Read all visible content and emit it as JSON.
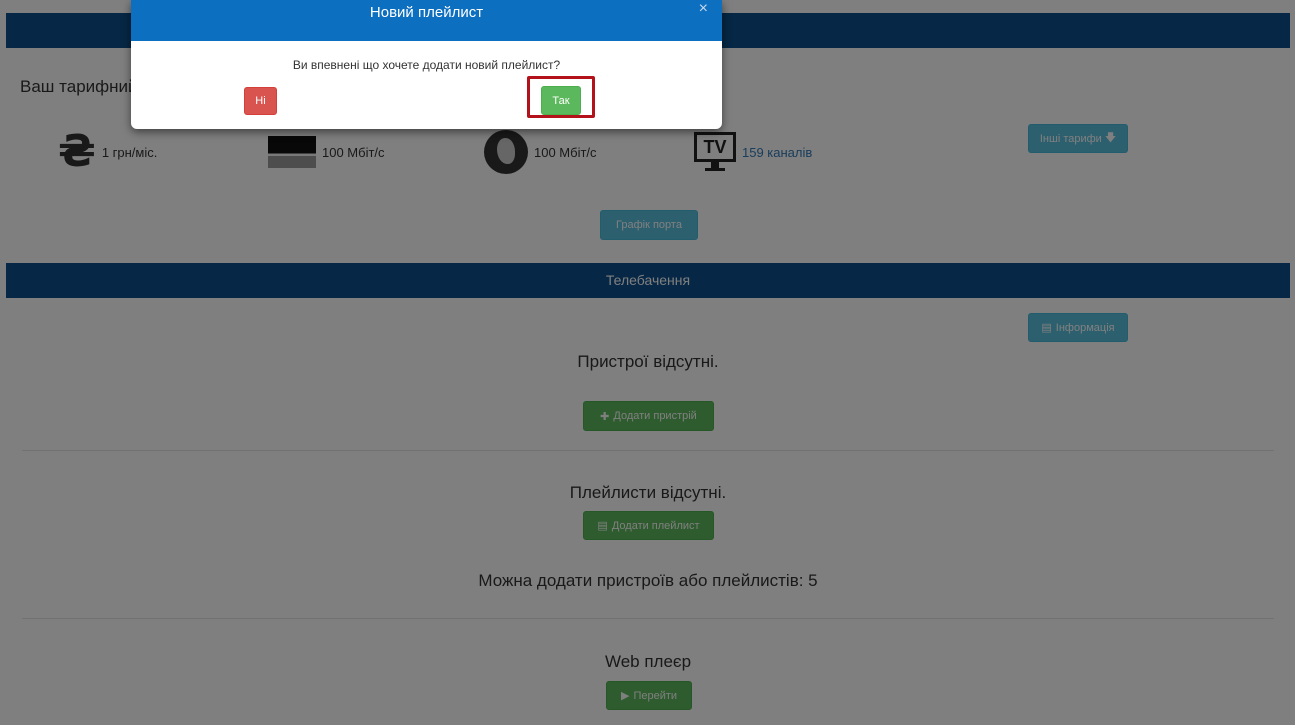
{
  "tariff": {
    "title": "Ваш тарифний план",
    "price": "1 грн/міс.",
    "speed_local": "100 Мбіт/с",
    "speed_world": "100 Мбіт/с",
    "channels": "159 каналів",
    "other_tariffs_label": "Інші тарифи",
    "port_graph_label": "Графік порта"
  },
  "tv": {
    "section_title": "Телебачення",
    "info_label": "Інформація",
    "no_devices": "Пристрої відсутні.",
    "add_device_label": "Додати пристрій",
    "no_playlists": "Плейлисти відсутні.",
    "add_playlist_label": "Додати плейлист",
    "can_add_text": "Можна додати пристроїв або плейлистів: 5",
    "web_player_title": "Web плеєр",
    "go_label": "Перейти"
  },
  "modal": {
    "title": "Новий плейлист",
    "close_symbol": "×",
    "message": "Ви впевнені що хочете додати новий плейлист?",
    "no_label": "Ні",
    "yes_label": "Так"
  },
  "icons": {
    "hryvnia": "₴",
    "tv_text": "TV",
    "plus": "✚",
    "list": "▤",
    "play": "▶",
    "arrow_down": "🡇"
  },
  "colors": {
    "header_blue": "#0d4f8b",
    "modal_header": "#0d6fc0",
    "info": "#5bc0de",
    "success": "#5cb85c",
    "danger": "#d9534f",
    "highlight": "#b3121b"
  }
}
